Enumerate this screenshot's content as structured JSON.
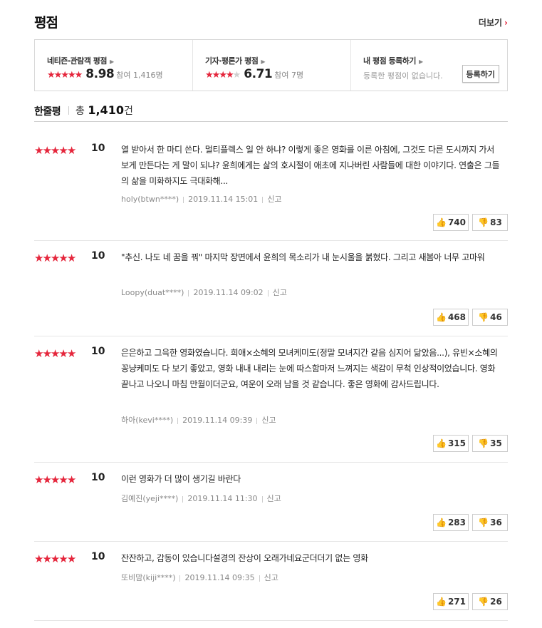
{
  "header": {
    "title": "평점",
    "more_label": "더보기",
    "more_arrow": "›"
  },
  "summary": {
    "audience": {
      "label": "네티즌·관람객 평점",
      "score": "8.98",
      "count_text": "참여 1,416명",
      "stars_full": 4,
      "stars_half": 1
    },
    "critic": {
      "label": "기자·평론가 평점",
      "score": "6.71",
      "count_text": "참여 7명",
      "stars_full": 3,
      "stars_half": 1
    },
    "mine": {
      "label": "내 평점 등록하기",
      "note": "등록한 평점이 없습니다.",
      "button_label": "등록하기"
    }
  },
  "list_header": {
    "title": "한줄평",
    "total_prefix": "총 ",
    "total_count": "1,410",
    "total_suffix": "건"
  },
  "reviews": [
    {
      "score": "10",
      "text": "열 받아서 한 마디 쓴다. 멀티플렉스 일 안 하냐? 이렇게 좋은 영화를 이른 아침에, 그것도 다른 도시까지 가서 보게 만든다는 게 말이 되냐? 윤희에게는 삶의 호시절이 애초에 지나버린 사람들에 대한 이야기다. 연출은 그들의 삶을 미화하지도 극대화해...",
      "user": "holy(btwn****)",
      "date": "2019.11.14 15:01",
      "report": "신고",
      "up": "740",
      "down": "83"
    },
    {
      "score": "10",
      "text": "\"추신. 나도 네 꿈을 꿔\" 마지막 장면에서 윤희의 목소리가 내 눈시울을 붉혔다. 그리고 새봄아 너무 고마워",
      "user": "Loopy(duat****)",
      "date": "2019.11.14 09:02",
      "report": "신고",
      "up": "468",
      "down": "46"
    },
    {
      "score": "10",
      "text": "은은하고 그윽한 영화였습니다. 희애×소혜의 모녀케미도(정말 모녀지간 같음 심지어 닮았음...), 유빈×소혜의 꽁냥케미도 다 보기 좋았고, 영화 내내 내리는 눈에 따스함마저 느껴지는 색감이 무척 인상적이었습니다. 영화 끝나고 나오니 마침 만월이더군요, 여운이 오래 남을 것 같습니다. 좋은 영화에 감사드립니다.",
      "user": "하아(kevi****)",
      "date": "2019.11.14 09:39",
      "report": "신고",
      "up": "315",
      "down": "35"
    },
    {
      "score": "10",
      "text": "이런 영화가 더 많이 생기길 바란다",
      "user": "김예진(yeji****)",
      "date": "2019.11.14 11:30",
      "report": "신고",
      "up": "283",
      "down": "36"
    },
    {
      "score": "10",
      "text": "잔잔하고, 감동이 있습니다설경의 잔상이 오래가네요군더더기 없는 영화",
      "user": "또비맘(kiji****)",
      "date": "2019.11.14 09:35",
      "report": "신고",
      "up": "271",
      "down": "26"
    }
  ],
  "colors": {
    "accent": "#e5263c",
    "text": "#222222",
    "muted": "#888888",
    "border": "#d8d8d8"
  },
  "icons": {
    "star": "star-icon",
    "thumb_up": "thumb-up-icon",
    "thumb_down": "thumb-down-icon"
  }
}
